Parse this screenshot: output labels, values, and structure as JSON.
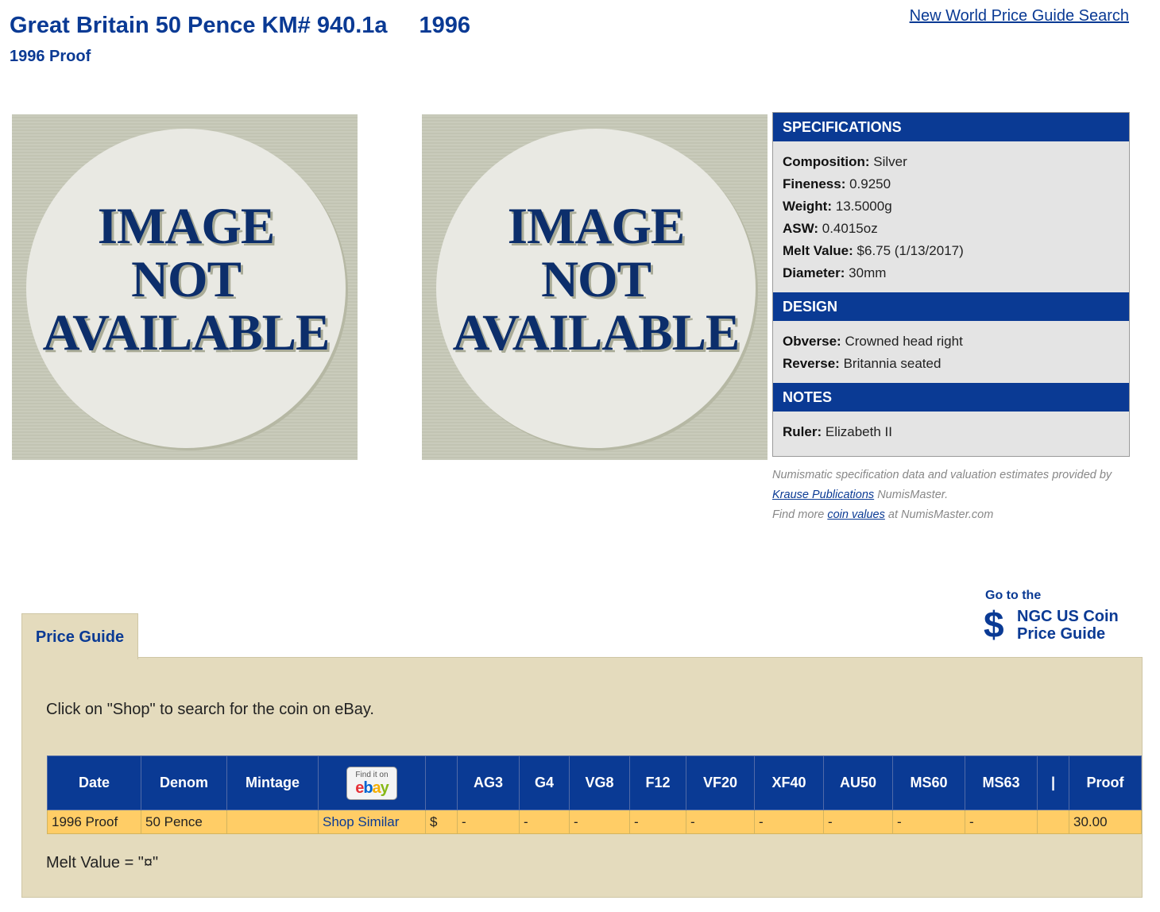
{
  "header": {
    "title": "Great Britain 50 Pence KM# 940.1a",
    "year": "1996",
    "subtitle": "1996 Proof",
    "search_link": "New World Price Guide Search"
  },
  "images": {
    "line1": "IMAGE",
    "line2": "NOT",
    "line3": "AVAILABLE"
  },
  "specifications": {
    "heading": "SPECIFICATIONS",
    "items": [
      {
        "label": "Composition:",
        "value": "Silver"
      },
      {
        "label": "Fineness:",
        "value": "0.9250"
      },
      {
        "label": "Weight:",
        "value": "13.5000g"
      },
      {
        "label": "ASW:",
        "value": "0.4015oz"
      },
      {
        "label": "Melt Value:",
        "value": "$6.75 (1/13/2017)"
      },
      {
        "label": "Diameter:",
        "value": "30mm"
      }
    ]
  },
  "design": {
    "heading": "DESIGN",
    "items": [
      {
        "label": "Obverse:",
        "value": "Crowned head right"
      },
      {
        "label": "Reverse:",
        "value": "Britannia seated"
      }
    ]
  },
  "notes": {
    "heading": "NOTES",
    "items": [
      {
        "label": "Ruler:",
        "value": "Elizabeth II"
      }
    ]
  },
  "credit": {
    "text1": "Numismatic specification data and valuation estimates provided by",
    "link1": "Krause Publications",
    "text2": "NumisMaster.",
    "text3": "Find more",
    "link2": "coin values",
    "text4": "at NumisMaster.com"
  },
  "ngc": {
    "goto": "Go to the",
    "dollar": "$",
    "line1": "NGC US Coin",
    "line2": "Price Guide"
  },
  "price_guide": {
    "tab_label": "Price Guide",
    "instructions": "Click on \"Shop\" to search for the coin on eBay.",
    "ebay_small": "Find it on",
    "columns": [
      "Date",
      "Denom",
      "Mintage",
      "",
      "",
      "AG3",
      "G4",
      "VG8",
      "F12",
      "VF20",
      "XF40",
      "AU50",
      "MS60",
      "MS63",
      "|",
      "Proof"
    ],
    "row": [
      "1996 Proof",
      "50 Pence",
      "",
      "Shop Similar",
      "$",
      "-",
      "-",
      "-",
      "-",
      "-",
      "-",
      "-",
      "-",
      "-",
      "",
      "30.00"
    ],
    "melt_value": "Melt Value = \"¤\""
  }
}
